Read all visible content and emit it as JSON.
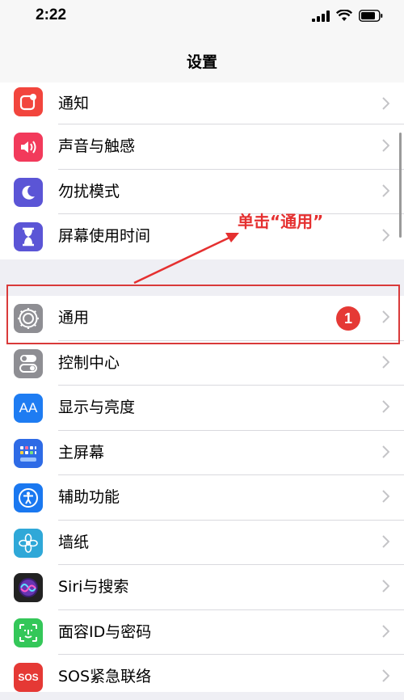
{
  "status_bar": {
    "time": "2:22"
  },
  "nav": {
    "title": "设置"
  },
  "group1": [
    {
      "label": "通知",
      "icon": "notifications-icon",
      "color": "#f2453d"
    },
    {
      "label": "声音与触感",
      "icon": "sound-icon",
      "color": "#f23a5b"
    },
    {
      "label": "勿扰模式",
      "icon": "moon-icon",
      "color": "#5b55d6"
    },
    {
      "label": "屏幕使用时间",
      "icon": "hourglass-icon",
      "color": "#5b55d6"
    }
  ],
  "group2": [
    {
      "label": "通用",
      "icon": "gear-icon",
      "color": "#8e8e93",
      "badge": "1"
    },
    {
      "label": "控制中心",
      "icon": "toggles-icon",
      "color": "#8e8e93"
    },
    {
      "label": "显示与亮度",
      "icon": "display-brightness-icon",
      "color": "#1e7cf2",
      "icon_text": "AA"
    },
    {
      "label": "主屏幕",
      "icon": "home-screen-icon",
      "color": "#2e6be6"
    },
    {
      "label": "辅助功能",
      "icon": "accessibility-icon",
      "color": "#1a78f0"
    },
    {
      "label": "墙纸",
      "icon": "wallpaper-icon",
      "color": "#2fa8d8"
    },
    {
      "label": "Siri与搜索",
      "icon": "siri-icon",
      "color": "#222222"
    },
    {
      "label": "面容ID与密码",
      "icon": "face-id-icon",
      "color": "#34c759"
    },
    {
      "label": "SOS紧急联络",
      "icon": "sos-icon",
      "color": "#e53935",
      "icon_text": "SOS"
    }
  ],
  "annotation": {
    "text": "单击“通用”",
    "color": "#e53030"
  }
}
